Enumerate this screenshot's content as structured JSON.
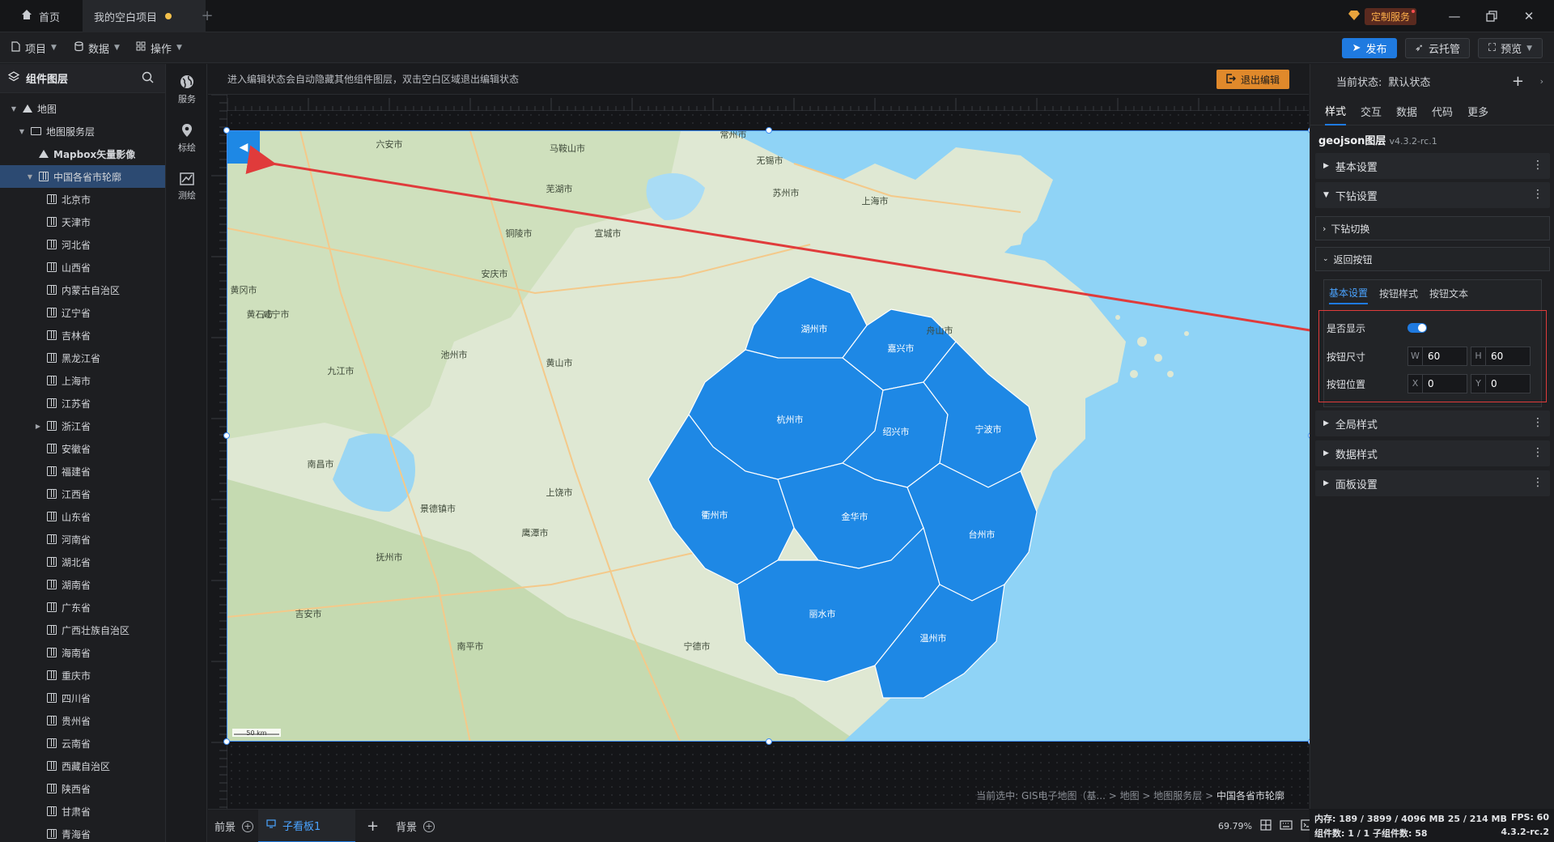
{
  "titlebar": {
    "home_tab": "首页",
    "project_tab": "我的空白项目",
    "custom_service": "定制服务"
  },
  "menubar": {
    "project": "项目",
    "data": "数据",
    "operation": "操作",
    "publish": "发布",
    "cloud_host": "云托管",
    "preview": "预览"
  },
  "layers": {
    "title": "组件图层",
    "items": [
      {
        "label": "地图",
        "icon": "map-icon"
      },
      {
        "label": "地图服务层",
        "icon": "folder-icon"
      },
      {
        "label": "Mapbox矢量影像",
        "icon": "map-icon"
      },
      {
        "label": "中国各省市轮廓",
        "icon": "book-icon"
      },
      {
        "label": "北京市"
      },
      {
        "label": "天津市"
      },
      {
        "label": "河北省"
      },
      {
        "label": "山西省"
      },
      {
        "label": "内蒙古自治区"
      },
      {
        "label": "辽宁省"
      },
      {
        "label": "吉林省"
      },
      {
        "label": "黑龙江省"
      },
      {
        "label": "上海市"
      },
      {
        "label": "江苏省"
      },
      {
        "label": "浙江省"
      },
      {
        "label": "安徽省"
      },
      {
        "label": "福建省"
      },
      {
        "label": "江西省"
      },
      {
        "label": "山东省"
      },
      {
        "label": "河南省"
      },
      {
        "label": "湖北省"
      },
      {
        "label": "湖南省"
      },
      {
        "label": "广东省"
      },
      {
        "label": "广西壮族自治区"
      },
      {
        "label": "海南省"
      },
      {
        "label": "重庆市"
      },
      {
        "label": "四川省"
      },
      {
        "label": "贵州省"
      },
      {
        "label": "云南省"
      },
      {
        "label": "西藏自治区"
      },
      {
        "label": "陕西省"
      },
      {
        "label": "甘肃省"
      },
      {
        "label": "青海省"
      }
    ]
  },
  "sidetools": [
    {
      "label": "服务",
      "icon": "globe-icon"
    },
    {
      "label": "标绘",
      "icon": "pin-icon"
    },
    {
      "label": "测绘",
      "icon": "measure-icon"
    }
  ],
  "canvas": {
    "hint": "进入编辑状态会自动隐藏其他组件图层，双击空白区域退出编辑状态",
    "exit_edit": "退出编辑",
    "breadcrumb_prefix": "当前选中: GIS电子地图（基... > 地图 > 地图服务层 > ",
    "breadcrumb_current": "中国各省市轮廓"
  },
  "map": {
    "cities": [
      {
        "name": "湖州市"
      },
      {
        "name": "嘉兴市"
      },
      {
        "name": "杭州市"
      },
      {
        "name": "绍兴市"
      },
      {
        "name": "宁波市"
      },
      {
        "name": "金华市"
      },
      {
        "name": "衢州市"
      },
      {
        "name": "台州市"
      },
      {
        "name": "丽水市"
      },
      {
        "name": "温州市"
      }
    ],
    "labels": [
      {
        "name": "六安市"
      },
      {
        "name": "马鞍山市"
      },
      {
        "name": "常州市"
      },
      {
        "name": "无锡市"
      },
      {
        "name": "苏州市"
      },
      {
        "name": "上海市"
      },
      {
        "name": "芜湖市"
      },
      {
        "name": "铜陵市"
      },
      {
        "name": "宣城市"
      },
      {
        "name": "安庆市"
      },
      {
        "name": "池州市"
      },
      {
        "name": "黄冈市"
      },
      {
        "name": "九江市"
      },
      {
        "name": "南昌市"
      },
      {
        "name": "上饶市"
      },
      {
        "name": "景德镇市"
      },
      {
        "name": "黄山市"
      },
      {
        "name": "舟山市"
      },
      {
        "name": "抚州市"
      },
      {
        "name": "吉安市"
      },
      {
        "name": "宁德市"
      },
      {
        "name": "南平市"
      },
      {
        "name": "黄石市"
      },
      {
        "name": "咸宁市"
      },
      {
        "name": "鹰潭市"
      }
    ],
    "scale": "50 km",
    "back_arrow": "◀"
  },
  "bottombar": {
    "foreground": "前景",
    "sub_board": "子看板1",
    "background": "背景",
    "zoom": "69.79%"
  },
  "rightpanel": {
    "state_label": "当前状态:",
    "state_value": "默认状态",
    "tabs": [
      "样式",
      "交互",
      "数据",
      "代码",
      "更多"
    ],
    "layer_name": "geojson图层",
    "layer_version": "v4.3.2-rc.1",
    "sections": {
      "basic": "基本设置",
      "drill": "下钻设置",
      "drill_switch": "下钻切换",
      "back_button": "返回按钮",
      "global_style": "全局样式",
      "data_style": "数据样式",
      "panel_setting": "面板设置"
    },
    "sub_tabs": [
      "基本设置",
      "按钮样式",
      "按钮文本"
    ],
    "form": {
      "show_label": "是否显示",
      "show_value": true,
      "size_label": "按钮尺寸",
      "w_tag": "W",
      "w_value": "60",
      "h_tag": "H",
      "h_value": "60",
      "pos_label": "按钮位置",
      "x_tag": "X",
      "x_value": "0",
      "y_tag": "Y",
      "y_value": "0"
    }
  },
  "status": {
    "memory": "内存: 189 / 3899 / 4096 MB 25 / 214 MB",
    "components": "组件数: 1 / 1   子组件数: 58",
    "fps": "FPS: 60",
    "version": "4.3.2-rc.2"
  },
  "colors": {
    "accent": "#1f7ae0",
    "zhejiang_fill": "#1e88e5",
    "sea": "#8fd3f6",
    "land": "#dfe8d3",
    "annotation": "#e03b3b"
  }
}
